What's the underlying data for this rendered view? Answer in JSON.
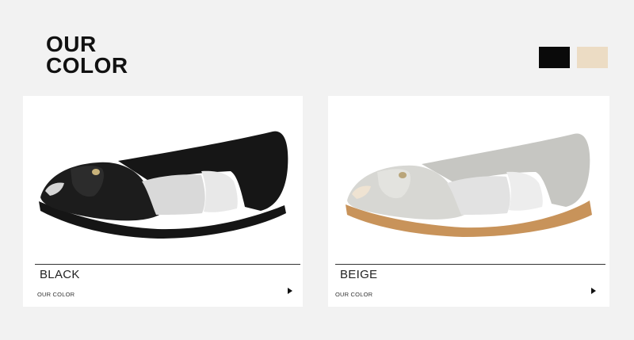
{
  "heading": {
    "line1": "OUR",
    "line2": "COLOR"
  },
  "swatches": [
    {
      "name": "black",
      "color": "#0a0a0a"
    },
    {
      "name": "beige",
      "color": "#ecdcc4"
    }
  ],
  "products": [
    {
      "color_label": "BLACK",
      "subtitle": "OUR COLOR"
    },
    {
      "color_label": "BEIGE",
      "subtitle": "OUR COLOR"
    }
  ]
}
